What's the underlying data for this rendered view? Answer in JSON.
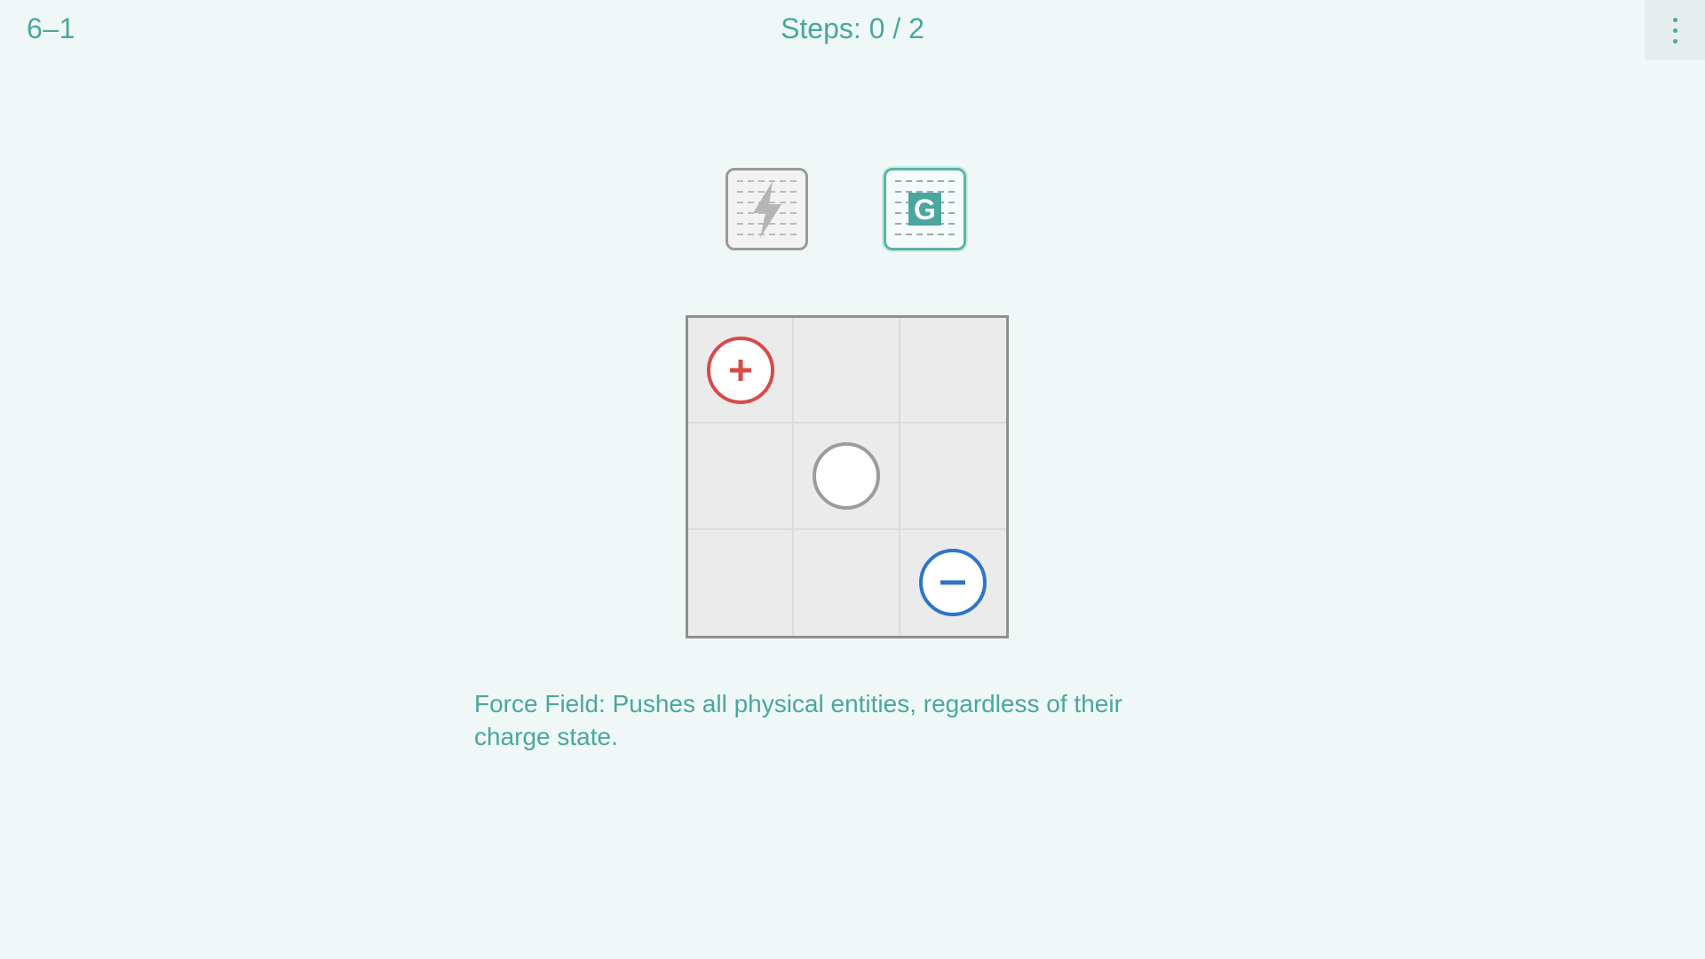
{
  "header": {
    "level": "6–1",
    "steps": "Steps: 0 / 2",
    "menu_icon": "more-vertical-icon"
  },
  "tools": [
    {
      "id": "lightning",
      "icon": "lightning-icon",
      "selected": false
    },
    {
      "id": "gravity",
      "icon": "gravity-g-icon",
      "letter": "G",
      "selected": true
    }
  ],
  "board": {
    "rows": 3,
    "cols": 3,
    "pieces": [
      {
        "row": 0,
        "col": 0,
        "type": "positive",
        "symbol": "+"
      },
      {
        "row": 1,
        "col": 1,
        "type": "neutral",
        "symbol": ""
      },
      {
        "row": 2,
        "col": 2,
        "type": "negative",
        "symbol": "−"
      }
    ]
  },
  "description": "Force Field: Pushes all physical entities, regardless of their charge state.",
  "colors": {
    "background": "#eff8f7",
    "accent": "#4aa79f",
    "positive": "#d94a4a",
    "negative": "#2f74c9",
    "neutral": "#9c9c9c"
  }
}
